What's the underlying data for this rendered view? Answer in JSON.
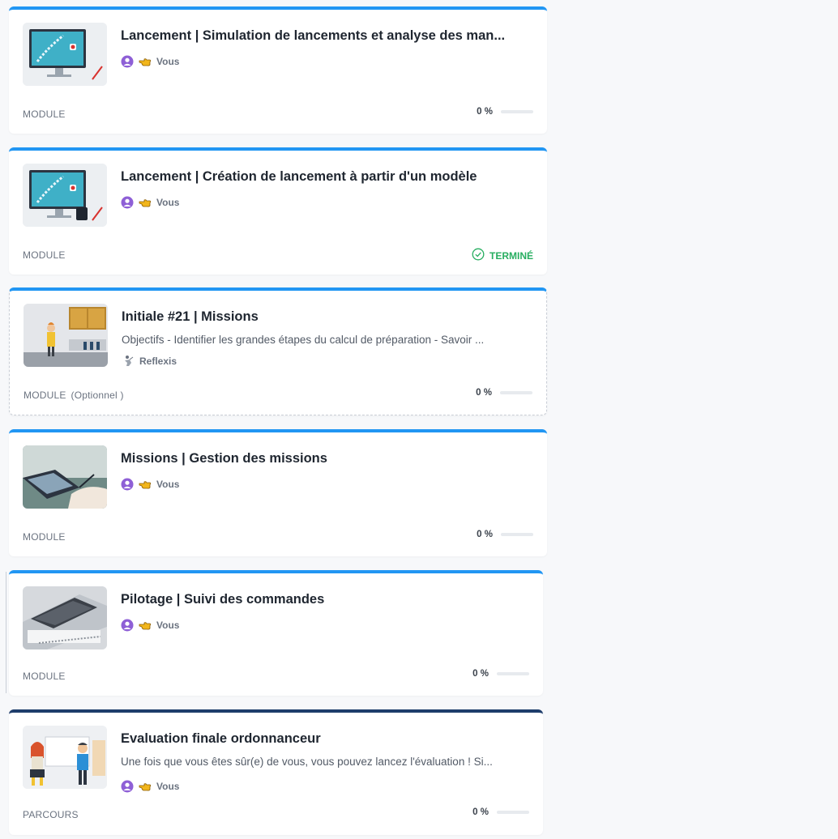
{
  "colors": {
    "accent": "#2196f3",
    "parcours_accent": "#1e3d6b",
    "done": "#27ae60",
    "author_icon": "#8e5fd6"
  },
  "cards": [
    {
      "title": "Lancement | Simulation de lancements et analyse des man...",
      "author": "Vous",
      "type": "MODULE",
      "progress": "0 %",
      "progress_value": 0
    },
    {
      "title": "Lancement | Création de lancement à partir d'un modèle",
      "author": "Vous",
      "type": "MODULE",
      "status": "TERMINÉ"
    },
    {
      "title": "Initiale #21 | Missions",
      "description": "Objectifs - Identifier les grandes étapes du calcul de préparation - Savoir ...",
      "author": "Reflexis",
      "type": "MODULE",
      "optional_label": "(Optionnel )",
      "progress": "0 %",
      "progress_value": 0
    },
    {
      "title": "Missions | Gestion des missions",
      "author": "Vous",
      "type": "MODULE",
      "progress": "0 %",
      "progress_value": 0
    },
    {
      "title": "Pilotage | Suivi des commandes",
      "author": "Vous",
      "type": "MODULE",
      "progress": "0 %",
      "progress_value": 0
    },
    {
      "title": "Evaluation finale ordonnanceur",
      "description": "Une fois que vous êtes sûr(e) de vous, vous pouvez lancez l'évaluation ! Si...",
      "author": "Vous",
      "type": "PARCOURS",
      "progress": "0 %",
      "progress_value": 0
    }
  ]
}
